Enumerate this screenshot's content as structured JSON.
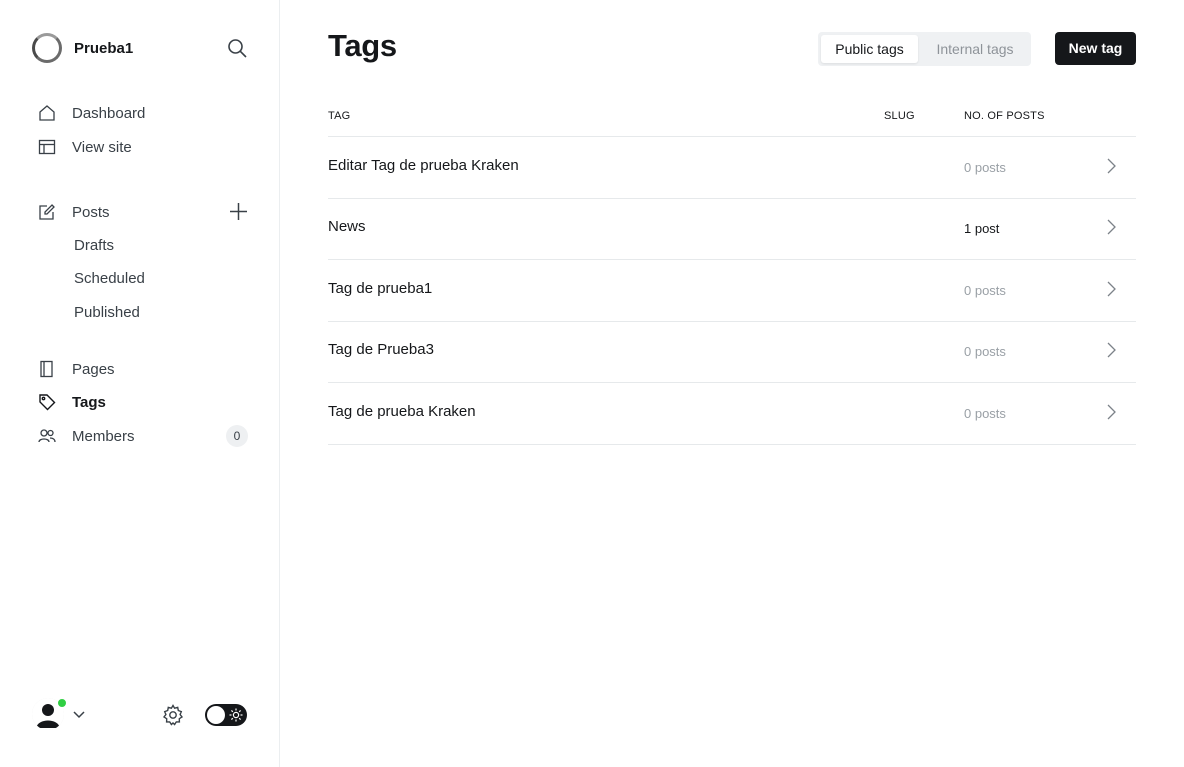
{
  "site": {
    "name": "Prueba1"
  },
  "nav": {
    "dashboard": "Dashboard",
    "view_site": "View site",
    "posts": "Posts",
    "drafts": "Drafts",
    "scheduled": "Scheduled",
    "published": "Published",
    "pages": "Pages",
    "tags": "Tags",
    "members": "Members",
    "members_count": "0"
  },
  "header": {
    "title": "Tags",
    "public_tab": "Public tags",
    "internal_tab": "Internal tags",
    "new_button": "New tag"
  },
  "table": {
    "columns": {
      "tag": "TAG",
      "slug": "SLUG",
      "posts": "NO. OF POSTS"
    },
    "rows": [
      {
        "name": "Editar Tag de prueba Kraken",
        "posts": "0 posts"
      },
      {
        "name": "News",
        "posts": "1 post"
      },
      {
        "name": "Tag de prueba1",
        "posts": "0 posts"
      },
      {
        "name": "Tag de Prueba3",
        "posts": "0 posts"
      },
      {
        "name": "Tag de prueba Kraken",
        "posts": "0 posts"
      }
    ]
  },
  "colors": {
    "accent": "#15171a",
    "online": "#30cf43",
    "muted": "#9aa0a6"
  },
  "icons": [
    "site-logo-icon",
    "search-icon",
    "home-icon",
    "layout-icon",
    "edit-icon",
    "plus-icon",
    "page-icon",
    "tag-icon",
    "members-icon",
    "avatar-icon",
    "chevron-down-icon",
    "gear-icon",
    "sun-icon",
    "chevron-right-icon"
  ]
}
